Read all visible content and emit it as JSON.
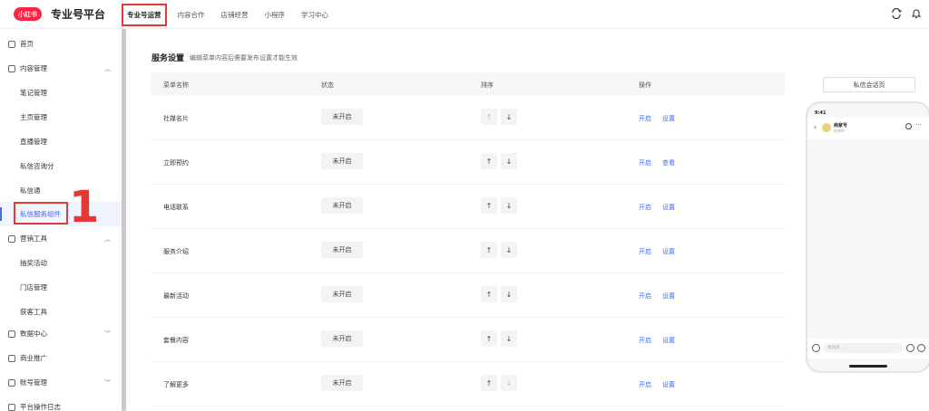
{
  "header": {
    "logo_text": "小红书",
    "platform_title": "专业号平台",
    "nav": [
      "专业号运营",
      "内容合作",
      "店铺经营",
      "小程序",
      "学习中心"
    ]
  },
  "sidebar": {
    "home": "首页",
    "content_mgmt": "内容管理",
    "content_items": [
      "笔记管理",
      "主页管理",
      "直播管理",
      "私信咨询分",
      "私信通",
      "私信服务组件"
    ],
    "marketing": "营销工具",
    "marketing_items": [
      "抽奖活动",
      "门店管理",
      "获客工具"
    ],
    "data_center": "数据中心",
    "ads": "商业推广",
    "account": "账号管理",
    "log": "平台操作日志"
  },
  "annotation": "1",
  "main": {
    "section_title": "服务设置",
    "section_note": "编辑菜单内容后需要发布设置才能生效",
    "columns": [
      "菜单名称",
      "状态",
      "排序",
      "操作"
    ],
    "rows": [
      {
        "name": "社媒名片",
        "status": "未开启",
        "op1": "开启",
        "op2": "设置"
      },
      {
        "name": "立即预约",
        "status": "未开启",
        "op1": "开启",
        "op2": "查看"
      },
      {
        "name": "电话联系",
        "status": "未开启",
        "op1": "开启",
        "op2": "设置"
      },
      {
        "name": "服务介绍",
        "status": "未开启",
        "op1": "开启",
        "op2": "设置"
      },
      {
        "name": "最新活动",
        "status": "未开启",
        "op1": "开启",
        "op2": "设置"
      },
      {
        "name": "套餐内容",
        "status": "未开启",
        "op1": "开启",
        "op2": "设置"
      },
      {
        "name": "了解更多",
        "status": "未开启",
        "op1": "开启",
        "op2": "设置"
      }
    ],
    "sort_up": "↑",
    "sort_down": "↓"
  },
  "preview": {
    "button": "私信会话页",
    "status_time": "9:41",
    "chat_name": "商家号",
    "chat_sub": "在线中",
    "input_placeholder": "发消息..."
  },
  "colors": {
    "brand": "#ff2442",
    "accent": "#3b6df5",
    "highlight": "#e53935"
  }
}
